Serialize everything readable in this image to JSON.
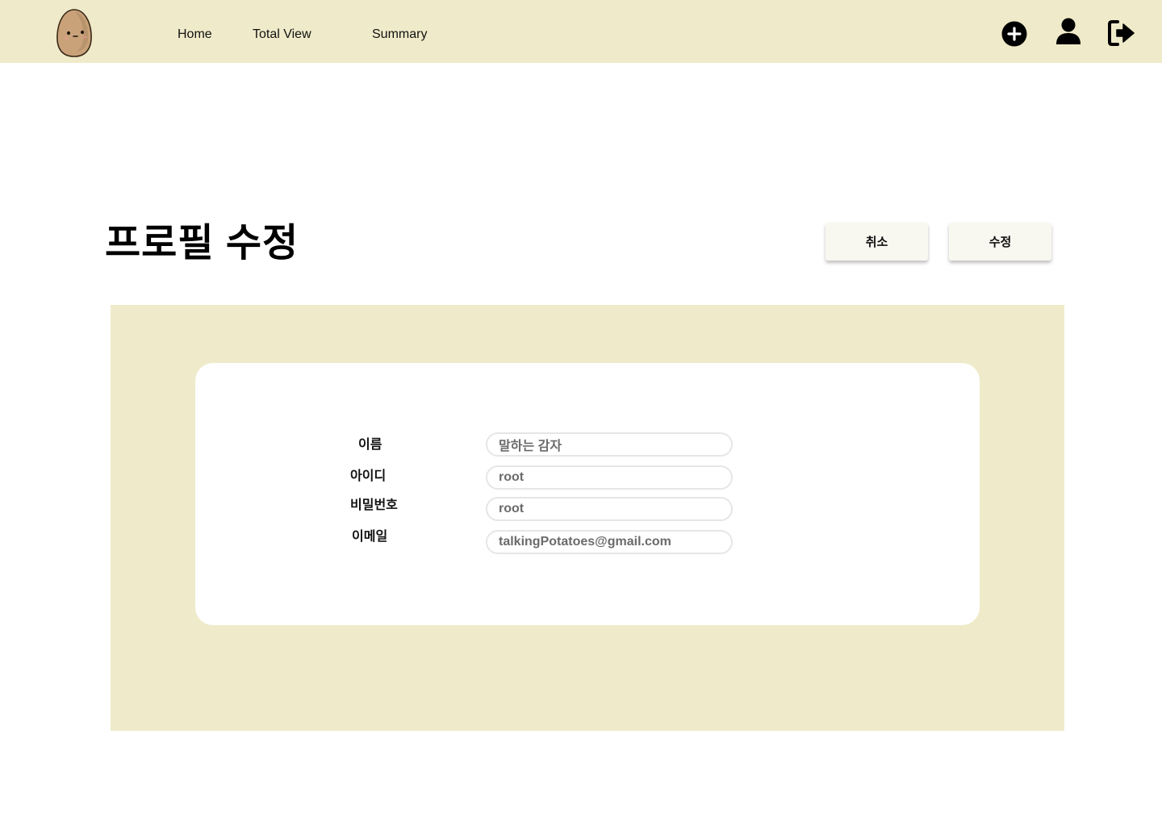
{
  "header": {
    "logo_icon": "potato-mascot-icon",
    "nav": {
      "home": "Home",
      "total_view": "Total View",
      "summary": "Summary"
    },
    "actions": {
      "add_icon": "plus-circle-icon",
      "profile_icon": "user-icon",
      "logout_icon": "sign-out-icon"
    }
  },
  "page": {
    "title": "프로필 수정",
    "cancel_label": "취소",
    "edit_label": "수정"
  },
  "form": {
    "name": {
      "label": "이름",
      "value": "말하는 감자"
    },
    "id": {
      "label": "아이디",
      "value": "root"
    },
    "password": {
      "label": "비밀번호",
      "value": "root"
    },
    "email": {
      "label": "이메일",
      "value": "talkingPotatoes@gmail.com"
    }
  },
  "colors": {
    "header_bg": "#efeac9",
    "panel_bg": "#efeac9",
    "card_bg": "#ffffff",
    "button_bg": "#f8f7f0"
  }
}
